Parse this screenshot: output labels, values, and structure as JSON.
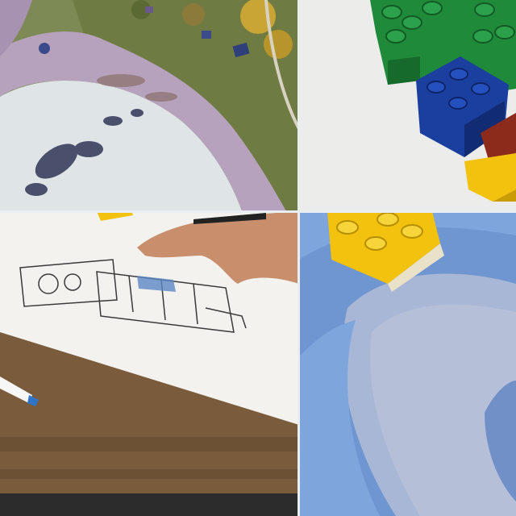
{
  "collage": {
    "tiles": [
      {
        "subject": "coastline-aerial"
      },
      {
        "subject": "toy-brick-tower"
      },
      {
        "subject": "hand-drawing-floorplan-sketch"
      },
      {
        "subject": "toy-brick-on-blue-wave-tray"
      }
    ]
  },
  "palette": {
    "sea_foam": "#dfe4e6",
    "beach_lilac": "#b6a2bd",
    "grass": "#7d8a4a",
    "brick_green": "#1f8a3a",
    "brick_blue": "#1b3f9e",
    "brick_yellow": "#f2c20f",
    "brick_red": "#8c2a1c",
    "paper": "#f3f2ee",
    "wood": "#8a6a45",
    "tray_blue": "#7ea6dd"
  }
}
